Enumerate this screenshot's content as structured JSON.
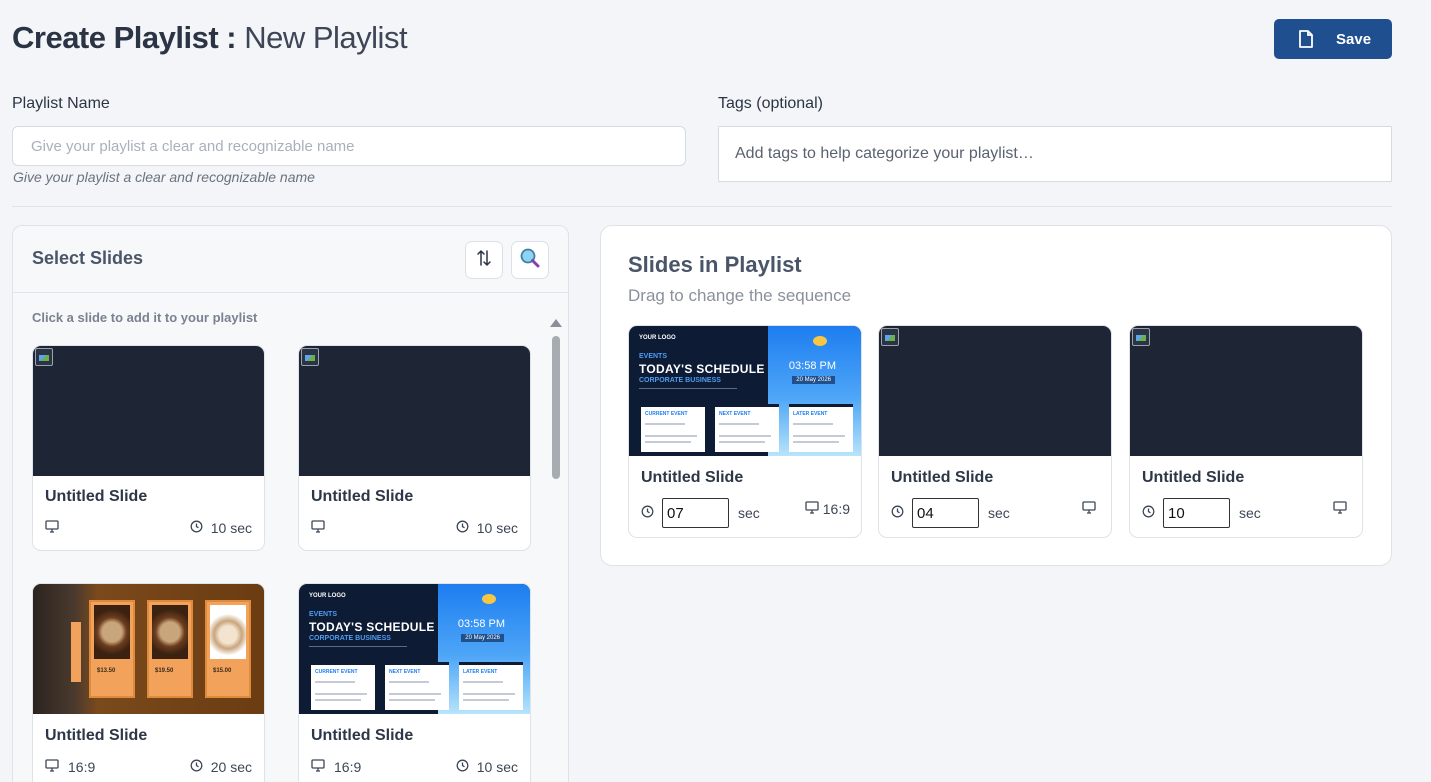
{
  "header": {
    "title_prefix": "Create Playlist :",
    "title_name": "New Playlist",
    "save_label": "Save"
  },
  "form": {
    "name_label": "Playlist Name",
    "name_placeholder": "Give your playlist a clear and recognizable name",
    "name_value": "",
    "name_hint": "Give your playlist a clear and recognizable name",
    "tags_label": "Tags (optional)",
    "tags_placeholder": "Add tags to help categorize your playlist…",
    "tags_value": ""
  },
  "select_panel": {
    "title": "Select Slides",
    "hint": "Click a slide to add it to your playlist",
    "sort_icon": "sort-icon",
    "search_icon": "search-icon",
    "slides": [
      {
        "title": "Untitled Slide",
        "thumbnail": "broken-image",
        "ratio": "",
        "duration": "10 sec"
      },
      {
        "title": "Untitled Slide",
        "thumbnail": "broken-image",
        "ratio": "",
        "duration": "10 sec"
      },
      {
        "title": "Untitled Slide",
        "thumbnail": "coffee-menu",
        "ratio": "16:9",
        "duration": "20 sec"
      },
      {
        "title": "Untitled Slide",
        "thumbnail": "event-schedule",
        "ratio": "16:9",
        "duration": "10 sec"
      }
    ]
  },
  "playlist_panel": {
    "title": "Slides in Playlist",
    "subtitle": "Drag to change the sequence",
    "unit": "sec",
    "slides": [
      {
        "title": "Untitled Slide",
        "thumbnail": "event-schedule",
        "duration": "07",
        "ratio": "16:9"
      },
      {
        "title": "Untitled Slide",
        "thumbnail": "broken-image",
        "duration": "04",
        "ratio": ""
      },
      {
        "title": "Untitled Slide",
        "thumbnail": "broken-image",
        "duration": "10",
        "ratio": ""
      }
    ]
  },
  "schedule_thumb": {
    "logo": "YOUR LOGO",
    "events": "EVENTS",
    "heading": "TODAY'S SCHEDULE",
    "company": "CORPORATE BUSINESS",
    "time": "03:58 PM",
    "date": "20 May 2026",
    "box1": "CURRENT EVENT",
    "box2": "NEXT EVENT",
    "box3": "LATER EVENT"
  },
  "colors": {
    "accent": "#1f4f8f",
    "background": "#f4f5f8",
    "dark_thumb": "#1e2636"
  }
}
